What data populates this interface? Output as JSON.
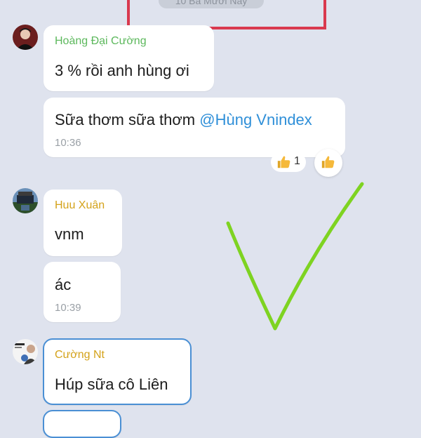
{
  "date_label": "10 Ba Mươi Nay",
  "messages": [
    {
      "sender": "Hoàng Đại Cường",
      "sender_color": "#5cb85c",
      "bubbles": [
        {
          "text": "3 % rồi anh hùng ơi"
        },
        {
          "text_before": "Sữa thơm sữa thơm ",
          "mention": "@Hùng Vnindex",
          "time": "10:36"
        }
      ],
      "reaction": {
        "icon": "thumbs-up-icon",
        "count": "1"
      }
    },
    {
      "sender": "Huu Xuân",
      "sender_color": "#d4a21a",
      "bubbles": [
        {
          "text": "vnm"
        },
        {
          "text": "ác",
          "time": "10:39"
        }
      ]
    },
    {
      "sender": "Cường Nt",
      "sender_color": "#d4a21a",
      "bubbles": [
        {
          "text": "Húp sữa cô Liên"
        }
      ]
    }
  ],
  "colors": {
    "background": "#dfe3ee",
    "mention": "#2f8fd8",
    "annotation_check": "#7ed321",
    "annotation_box": "#d9394e",
    "highlight_border": "#4a8fd4"
  }
}
